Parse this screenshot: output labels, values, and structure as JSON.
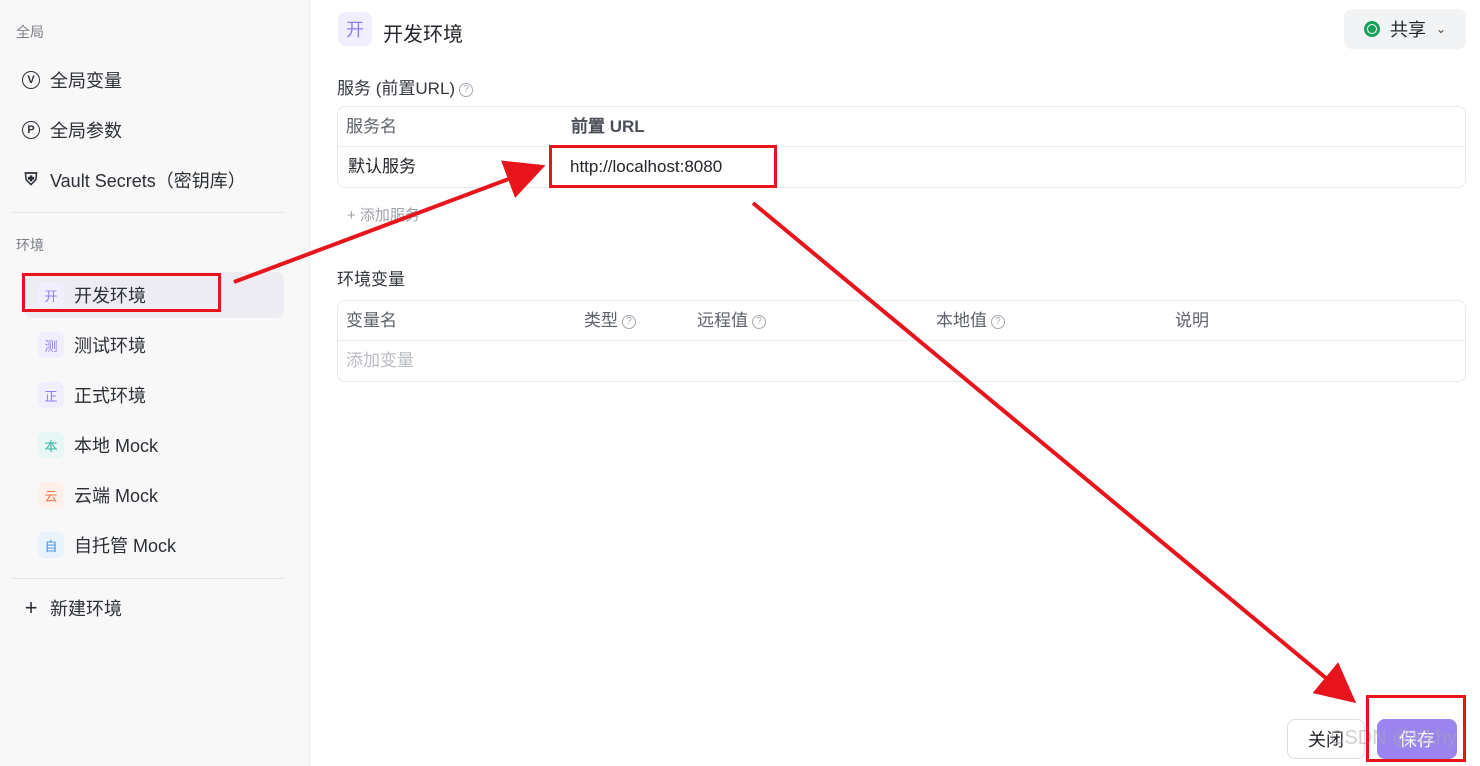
{
  "sidebar": {
    "global_label": "全局",
    "global_items": [
      {
        "label": "全局变量",
        "icon": "v-circle-icon",
        "glyph": "V"
      },
      {
        "label": "全局参数",
        "icon": "p-circle-icon",
        "glyph": "P"
      },
      {
        "label": "Vault Secrets（密钥库）",
        "icon": "shield-icon",
        "glyph": "⛨"
      }
    ],
    "env_label": "环境",
    "environments": [
      {
        "label": "开发环境",
        "badge": "开",
        "badge_bg": "#f1efff",
        "badge_color": "#8f7ef0",
        "active": true
      },
      {
        "label": "测试环境",
        "badge": "测",
        "badge_bg": "#f1efff",
        "badge_color": "#8f7ef0",
        "active": false
      },
      {
        "label": "正式环境",
        "badge": "正",
        "badge_bg": "#f1efff",
        "badge_color": "#8f7ef0",
        "active": false
      },
      {
        "label": "本地 Mock",
        "badge": "本",
        "badge_bg": "#e6f7f5",
        "badge_color": "#2bb3a0",
        "active": false
      },
      {
        "label": "云端 Mock",
        "badge": "云",
        "badge_bg": "#fff0ea",
        "badge_color": "#f07a4a",
        "active": false
      },
      {
        "label": "自托管 Mock",
        "badge": "自",
        "badge_bg": "#e8f3fd",
        "badge_color": "#3d8fe0",
        "active": false
      }
    ],
    "new_env_label": "新建环境"
  },
  "header": {
    "badge": "开",
    "title": "开发环境",
    "share_label": "共享",
    "share_icon": "globe-icon"
  },
  "services": {
    "title": "服务 (前置URL)",
    "columns": [
      "服务名",
      "前置 URL"
    ],
    "rows": [
      {
        "name": "默认服务",
        "url": "http://localhost:8080"
      }
    ],
    "add_label": "+ 添加服务"
  },
  "variables": {
    "title": "环境变量",
    "columns": [
      "变量名",
      "类型",
      "远程值",
      "本地值",
      "说明"
    ],
    "add_placeholder": "添加变量"
  },
  "footer": {
    "close_label": "关闭",
    "save_label": "保存",
    "watermark": "CSDN @Kkhy"
  },
  "colors": {
    "accent": "#9b84ef",
    "annotation": "#e8141c"
  }
}
